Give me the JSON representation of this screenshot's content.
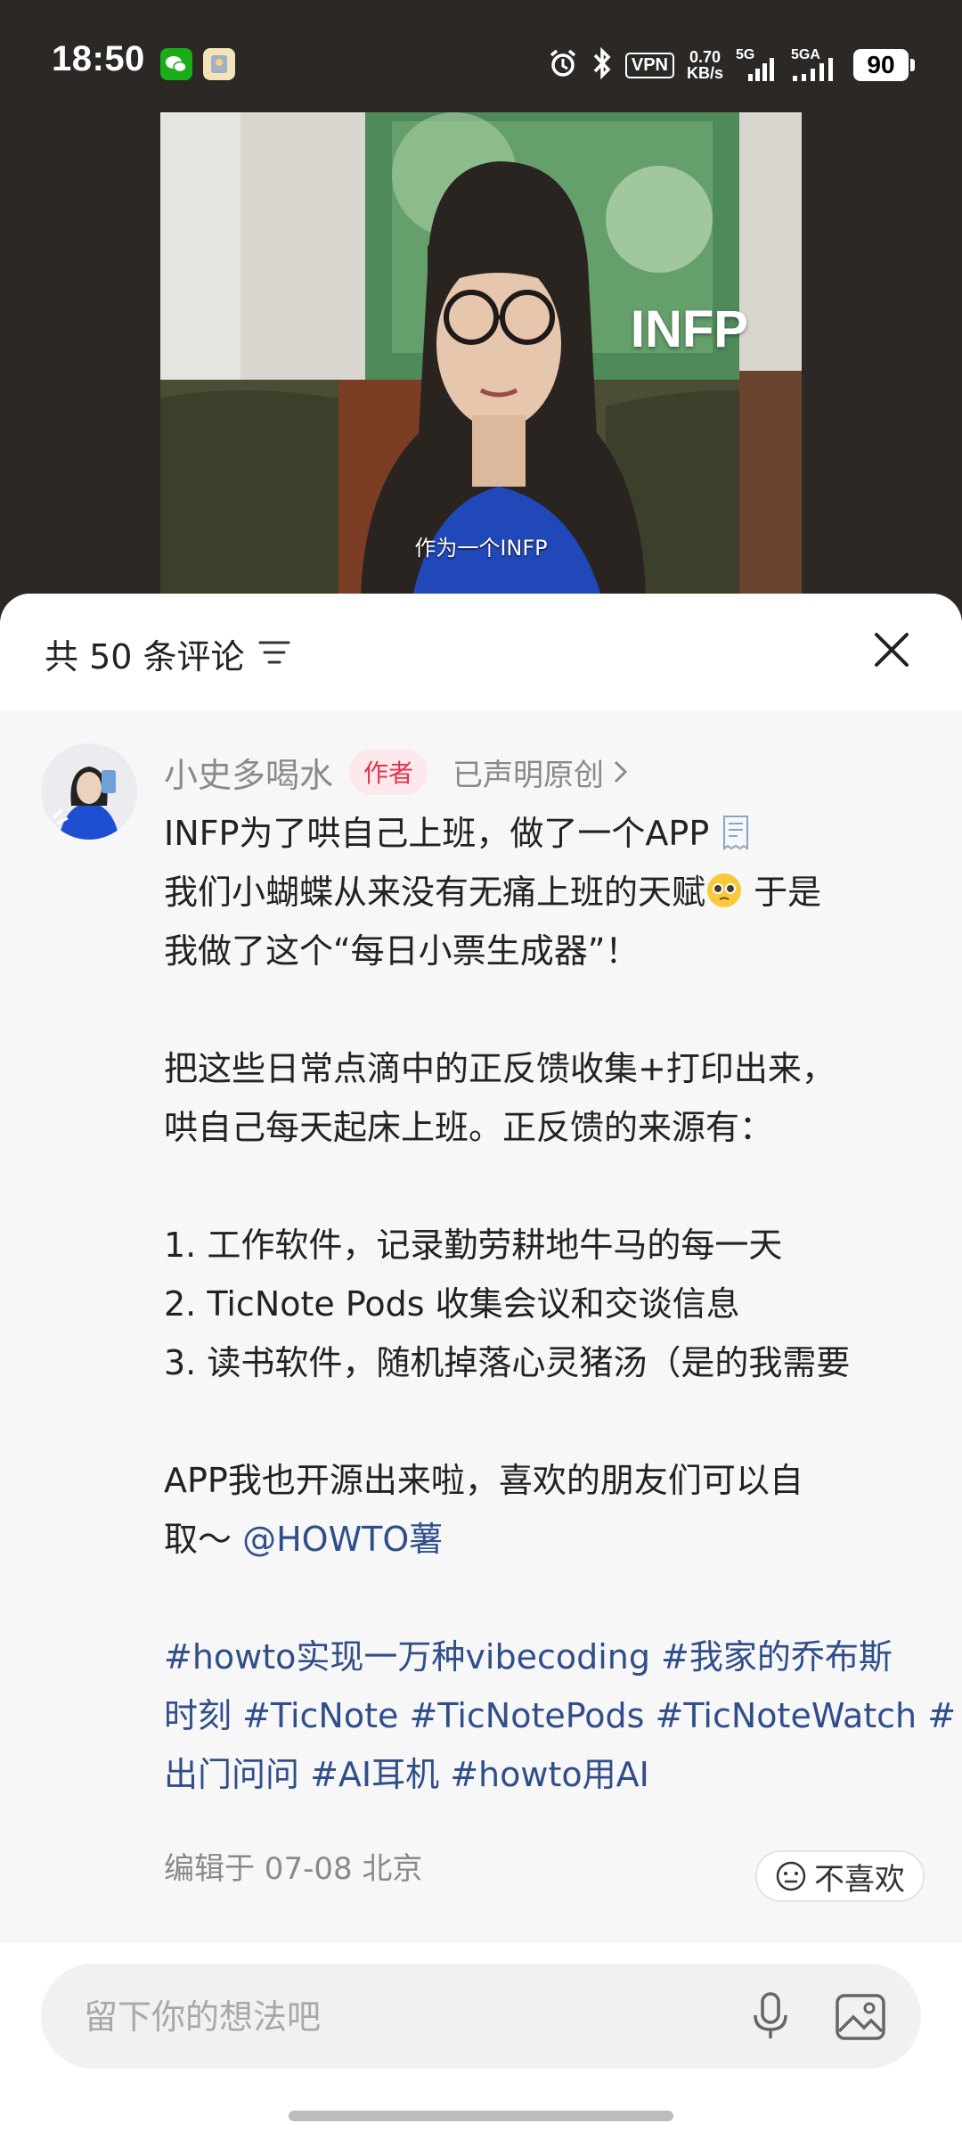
{
  "status_bar": {
    "time": "18:50",
    "net_speed_value": "0.70",
    "net_speed_unit": "KB/s",
    "vpn": "VPN",
    "signal1": "5G",
    "signal2": "5GA",
    "battery": "90"
  },
  "video": {
    "overlay_text": "INFP",
    "caption": "作为一个INFP"
  },
  "comments_header": {
    "title": "共 50 条评论"
  },
  "post": {
    "author": "小史多喝水",
    "author_badge": "作者",
    "original_label": "已声明原创",
    "lines": {
      "l1": "INFP为了哄自己上班，做了一个APP",
      "l2a": "我们小蝴蝶从来没有无痛上班的天赋",
      "l2b": " 于是",
      "l3": "我做了这个“每日小票生成器”！",
      "l4": "把这些日常点滴中的正反馈收集+打印出来，",
      "l5": "哄自己每天起床上班。正反馈的来源有：",
      "l6": "1. 工作软件，记录勤劳耕地牛马的每一天",
      "l7": "2. TicNote Pods 收集会议和交谈信息",
      "l8": "3. 读书软件，随机掉落心灵猪汤（是的我需要",
      "l9": "APP我也开源出来啦，喜欢的朋友们可以自",
      "l10a": "取～",
      "l10b": "@HOWTO薯",
      "l11": "#howto实现一万种vibecoding #我家的乔布斯",
      "l12": "时刻 #TicNote #TicNotePods #TicNoteWatch #",
      "l13": "出门问问 #AI耳机 #howto用AI"
    },
    "meta": "编辑于 07-08 北京",
    "dislike_label": "不喜欢"
  },
  "input": {
    "placeholder": "留下你的想法吧"
  },
  "colors": {
    "accent_red": "#e0354d",
    "link_blue": "#2f4e8a",
    "sheet_bg": "#f7f7f7"
  }
}
